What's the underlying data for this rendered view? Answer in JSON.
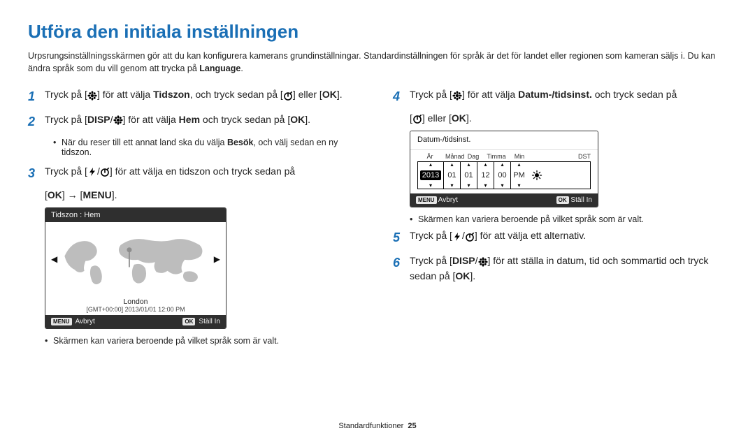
{
  "title": "Utföra den initiala inställningen",
  "intro_part1": "Urpsrungsinställningsskärmen gör att du kan konfigurera kamerans grundinställningar. Standardinställningen för språk är det för landet eller regionen som kameran säljs i. Du kan ändra språk som du vill genom att trycka på ",
  "intro_bold": "Language",
  "intro_part2": ".",
  "steps": {
    "s1a": "Tryck på [",
    "s1b": "] för att välja ",
    "s1bold": "Tidszon",
    "s1c": ", och tryck sedan på [",
    "s1d": "] eller [",
    "s1e": "].",
    "s2a": "Tryck på [",
    "s2b": "] för att välja ",
    "s2bold": "Hem",
    "s2c": " och tryck sedan på [",
    "s2d": "].",
    "s2_sub_a": "När du reser till ett annat land ska du välja ",
    "s2_sub_bold": "Besök",
    "s2_sub_b": ", och välj sedan en ny tidszon.",
    "s3a": "Tryck på [",
    "s3b": "] för att välja en tidszon och tryck sedan på",
    "s3_after_a": "[",
    "s3_after_b": "] → [",
    "s3_after_c": "].",
    "s4a": "Tryck på [",
    "s4b": "] för att välja ",
    "s4bold": "Datum-/tidsinst.",
    "s4c": " och tryck sedan på",
    "s4_after_a": "[",
    "s4_after_b": "] eller [",
    "s4_after_c": "].",
    "s5a": "Tryck på [",
    "s5b": "] för att välja ett alternativ.",
    "s6a": "Tryck på [",
    "s6b": "] för att ställa in datum, tid och sommartid och tryck sedan på [",
    "s6c": "]."
  },
  "note_variera": "Skärmen kan variera beroende på vilket språk som är valt.",
  "tz": {
    "title": "Tidszon : Hem",
    "city": "London",
    "meta": "[GMT+00:00] 2013/01/01 12:00 PM",
    "menu_label": "MENU",
    "cancel": "Avbryt",
    "ok_label": "OK",
    "set": "Ställ In"
  },
  "dt": {
    "title": "Datum-/tidsinst.",
    "headers": {
      "year": "År",
      "month": "Månad",
      "day": "Dag",
      "hour": "Timma",
      "min": "Min",
      "dst": "DST"
    },
    "values": {
      "year": "2013",
      "month": "01",
      "day": "01",
      "hour": "12",
      "min": "00",
      "ampm": "PM"
    },
    "menu_label": "MENU",
    "cancel": "Avbryt",
    "ok_label": "OK",
    "set": "Ställ In"
  },
  "icons": {
    "disp": "DISP",
    "ok": "OK",
    "menu": "MENU"
  },
  "footer": {
    "section": "Standardfunktioner",
    "page": "25"
  }
}
